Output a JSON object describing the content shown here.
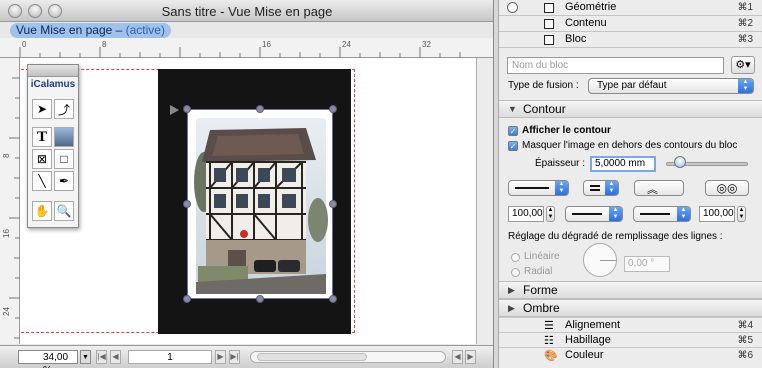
{
  "window": {
    "title": "Sans titre - Vue Mise en page"
  },
  "view_label": {
    "text": "Vue Mise en page – ",
    "state": "(active)"
  },
  "ruler": {
    "h_ticks": [
      "0",
      "8",
      "16",
      "24",
      "32"
    ],
    "v_ticks": [
      "8",
      "16",
      "24"
    ]
  },
  "palette": {
    "name": "iCalamus"
  },
  "tools": [
    "selection-arrow",
    "rotate-arrow",
    "text-tool",
    "image-tool",
    "frame-x-tool",
    "rectangle-tool",
    "line-tool",
    "pen-tool",
    "hand-tool",
    "zoom-tool"
  ],
  "bottombar": {
    "zoom": "34,00 %",
    "page": "1"
  },
  "inspector": {
    "nav": [
      {
        "label": "Géométrie",
        "key": "⌘1"
      },
      {
        "label": "Contenu",
        "key": "⌘2"
      },
      {
        "label": "Bloc",
        "key": "⌘3"
      }
    ],
    "name_placeholder": "Nom du bloc",
    "gear": "⚙▾",
    "fusion_label": "Type de fusion :",
    "fusion_value": "Type par défaut",
    "contour": {
      "title": "Contour",
      "show_contour": "Afficher le contour",
      "mask_image": "Masquer l'image en dehors des contours du bloc",
      "thickness_label": "Épaisseur :",
      "thickness_value": "5,0000 mm",
      "left_percent": "100,00",
      "right_percent": "100,00",
      "gradient_label": "Réglage du dégradé de remplissage des lignes :",
      "linear": "Linéaire",
      "radial": "Radial",
      "angle": "0,00 °"
    },
    "forme": "Forme",
    "ombre": "Ombre",
    "bottom_rows": [
      {
        "label": "Alignement",
        "key": "⌘4"
      },
      {
        "label": "Habillage",
        "key": "⌘5"
      },
      {
        "label": "Couleur",
        "key": "⌘6"
      }
    ]
  }
}
